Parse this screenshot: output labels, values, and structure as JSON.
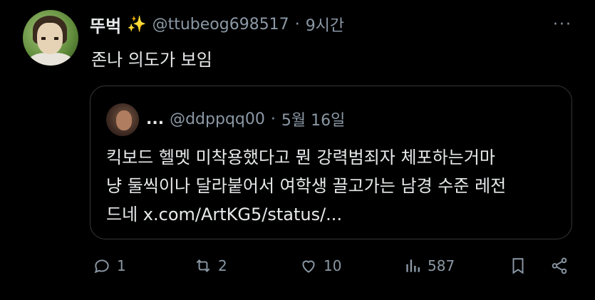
{
  "tweet": {
    "display_name": "뚜벅",
    "sparkle_emoji": "✨",
    "handle": "@ttubeog698517",
    "separator": "·",
    "time": "9시간",
    "more": "···",
    "text": "존나 의도가 보임"
  },
  "quote": {
    "name": "...",
    "handle": "@ddppqq00",
    "separator": "·",
    "time": "5월 16일",
    "lines": [
      "킥보드 헬멧 미착용했다고 뭔 강력범죄자 체포하는거마",
      "냥 둘씩이나 달라붙어서 여학생 끌고가는 남경 수준 레전",
      "드네 x.com/ArtKG5/status/..."
    ]
  },
  "actions": {
    "replies": "1",
    "retweets": "2",
    "likes": "10",
    "views": "587"
  }
}
